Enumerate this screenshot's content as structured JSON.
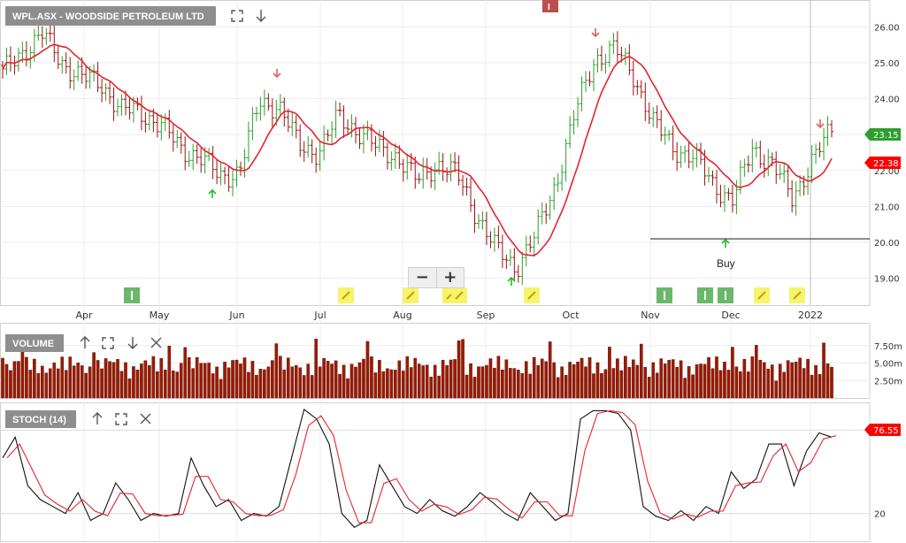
{
  "header": {
    "symbol_label": "WPL.ASX - WOODSIDE PETROLEUM LTD",
    "top_marker_label": "I"
  },
  "panels": {
    "volume_label": "VOLUME",
    "stoch_label": "STOCH (14)"
  },
  "zoom": {
    "minus_label": "−",
    "plus_label": "+"
  },
  "annotation": {
    "buy_label": "Buy"
  },
  "colors": {
    "ma_line": "#e8232d",
    "candle_up": "#2e9e2e",
    "candle_down": "#9b1010",
    "volume_bar": "#9b1a00",
    "stoch_k": "#111111",
    "stoch_d": "#e8232d",
    "badge_last": "#2e9e2e",
    "badge_ma": "#ff0000",
    "info_marker": "#6ab86a",
    "alert_marker": "#f7f36b",
    "label_bg": "#8e8e8e"
  },
  "chart_data": [
    {
      "type": "candlestick",
      "title": "WPL.ASX - WOODSIDE PETROLEUM LTD",
      "x_ticks": [
        "Apr",
        "May",
        "Jun",
        "Jul",
        "Aug",
        "Sep",
        "Oct",
        "Nov",
        "Dec",
        "2022"
      ],
      "y_ticks": [
        19.0,
        20.0,
        21.0,
        22.0,
        23.0,
        24.0,
        25.0,
        26.0
      ],
      "ylim": [
        18.6,
        26.4
      ],
      "last_price": "23.15",
      "ma_value": "22.38",
      "buy_level": 20.1,
      "price_anchors": [
        24.7,
        25.3,
        25.8,
        25.0,
        24.6,
        24.4,
        23.7,
        23.6,
        23.3,
        22.6,
        22.4,
        21.8,
        22.0,
        23.9,
        23.8,
        22.7,
        22.5,
        23.5,
        23.1,
        22.6,
        22.4,
        21.7,
        22.2,
        21.9,
        20.8,
        19.8,
        19.3,
        20.2,
        21.6,
        23.6,
        25.1,
        25.4,
        24.6,
        23.3,
        22.6,
        22.4,
        21.6,
        21.2,
        22.6,
        22.2,
        21.2,
        22.3,
        23.1
      ]
    },
    {
      "type": "bar",
      "title": "VOLUME",
      "y_ticks": [
        "2.50m",
        "5.00m",
        "7.50m"
      ]
    },
    {
      "type": "line",
      "title": "STOCH (14)",
      "y_ticks": [
        "20"
      ],
      "last_value": "76.55",
      "series": [
        {
          "values": [
            60,
            75,
            40,
            30,
            25,
            20,
            35,
            15,
            20,
            42,
            30,
            15,
            20,
            18,
            20,
            60,
            40,
            25,
            30,
            15,
            20,
            18,
            25,
            60,
            95,
            88,
            70,
            20,
            10,
            15,
            55,
            40,
            25,
            20,
            30,
            22,
            18,
            25,
            35,
            28,
            20,
            15,
            35,
            25,
            15,
            20,
            88,
            94,
            94,
            92,
            80,
            25,
            18,
            15,
            22,
            15,
            25,
            20,
            50,
            38,
            45,
            70,
            70,
            40,
            65,
            78,
            75
          ]
        }
      ]
    }
  ]
}
